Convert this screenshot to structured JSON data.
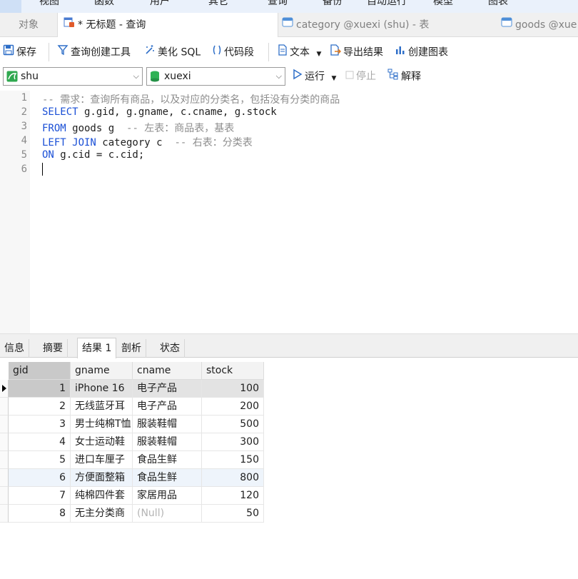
{
  "menu": {
    "items": [
      "视图",
      "函数",
      "用户",
      "其它",
      "查询",
      "备份",
      "自动运行",
      "模型",
      "图表"
    ]
  },
  "tabs": {
    "objects": "对象",
    "query_tab": "* 无标题 - 查询",
    "category_tab": "category @xuexi (shu) - 表",
    "goods_tab": "goods @xue"
  },
  "toolbar": {
    "save": "保存",
    "query_builder": "查询创建工具",
    "beautify_sql": "美化 SQL",
    "code_snippet": "代码段",
    "text": "文本",
    "export_result": "导出结果",
    "create_chart": "创建图表"
  },
  "connection": {
    "connection_name": "shu",
    "database_name": "xuexi",
    "run": "运行",
    "stop": "停止",
    "explain": "解释"
  },
  "editor": {
    "line_numbers": [
      "1",
      "2",
      "3",
      "4",
      "5",
      "6"
    ],
    "line1_comment": "-- 需求：查询所有商品，以及对应的分类名，包括没有分类的商品",
    "line2_kw": "SELECT",
    "line2_rest": " g.gid, g.gname, c.cname, g.stock",
    "line3_kw": "FROM",
    "line3_rest": " goods g  ",
    "line3_comment": "-- 左表：商品表，基表",
    "line4_kw": "LEFT JOIN",
    "line4_rest": " category c  ",
    "line4_comment": "-- 右表：分类表",
    "line5_kw": "ON",
    "line5_rest": " g.cid = c.cid;"
  },
  "result_tabs": [
    "信息",
    "摘要",
    "结果 1",
    "剖析",
    "状态"
  ],
  "grid": {
    "columns": [
      "gid",
      "gname",
      "cname",
      "stock"
    ],
    "rows": [
      {
        "gid": "1",
        "gname": "iPhone 16",
        "cname": "电子产品",
        "stock": "100"
      },
      {
        "gid": "2",
        "gname": "无线蓝牙耳",
        "cname": "电子产品",
        "stock": "200"
      },
      {
        "gid": "3",
        "gname": "男士纯棉T恤",
        "cname": "服装鞋帽",
        "stock": "500"
      },
      {
        "gid": "4",
        "gname": "女士运动鞋",
        "cname": "服装鞋帽",
        "stock": "300"
      },
      {
        "gid": "5",
        "gname": "进口车厘子",
        "cname": "食品生鲜",
        "stock": "150"
      },
      {
        "gid": "6",
        "gname": "方便面整箱",
        "cname": "食品生鲜",
        "stock": "800"
      },
      {
        "gid": "7",
        "gname": "纯棉四件套",
        "cname": "家居用品",
        "stock": "120"
      },
      {
        "gid": "8",
        "gname": "无主分类商",
        "cname": "(Null)",
        "stock": "50"
      }
    ]
  },
  "colors": {
    "keyword": "#1a4fd6",
    "comment": "#8d8d8d",
    "selected_row": "#d9d9d9",
    "null_text": "#b4b4b4"
  }
}
